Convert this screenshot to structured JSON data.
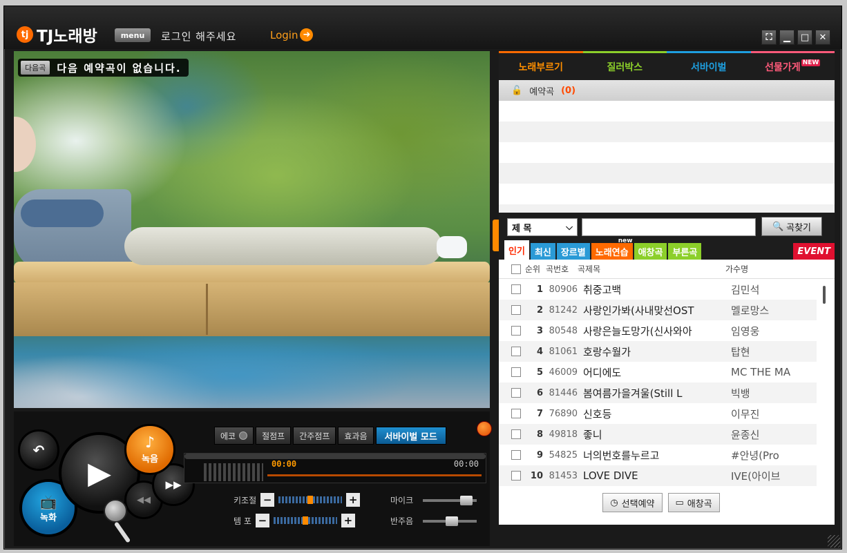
{
  "app": {
    "logo_text": "TJ노래방",
    "logo_badge": "tj",
    "menu_label": "menu",
    "login_message": "로그인 해주세요",
    "login_link": "Login",
    "window_controls": [
      "fullscreen-icon",
      "minimize-icon",
      "maximize-icon",
      "close-icon"
    ]
  },
  "video": {
    "next_tag": "다음곡",
    "next_message": "다음 예약곡이 없습니다."
  },
  "player": {
    "effects": {
      "echo": "에코",
      "half_jump": "절점프",
      "interlude_jump": "간주점프",
      "sound_effect": "효과음",
      "survival_mode": "서바이벌 모드"
    },
    "record_label": "녹음",
    "video_label": "녹화",
    "time_current": "00:00",
    "time_total": "00:00",
    "key_label": "키조절",
    "tempo_label": "템  포",
    "mic_label": "마이크",
    "accomp_label": "반주음",
    "key_level": 0.5,
    "tempo_level": 0.5,
    "mic_level": 0.9,
    "accomp_level": 0.55
  },
  "right_tabs": [
    "노래부르기",
    "질러박스",
    "서바이벌",
    "선물가게"
  ],
  "right_tabs_new": "NEW",
  "reserve": {
    "label": "예약곡",
    "count": "(0)"
  },
  "search": {
    "select_value": "제 목",
    "button_label": "곡찾기",
    "input_value": ""
  },
  "categories": [
    "인기",
    "최신",
    "장르별",
    "노래연습",
    "애창곡",
    "부른곡"
  ],
  "practice_new": "new",
  "event_label": "EVENT",
  "list_headers": {
    "rank": "순위",
    "number": "곡번호",
    "title": "곡제목",
    "artist": "가수명"
  },
  "songs": [
    {
      "rank": "1",
      "number": "80906",
      "title": "취중고백",
      "artist": "김민석"
    },
    {
      "rank": "2",
      "number": "81242",
      "title": "사랑인가봐(사내맞선OST",
      "artist": "멜로망스"
    },
    {
      "rank": "3",
      "number": "80548",
      "title": "사랑은늘도망가(신사와아",
      "artist": "임영웅"
    },
    {
      "rank": "4",
      "number": "81061",
      "title": "호랑수월가",
      "artist": "탑현"
    },
    {
      "rank": "5",
      "number": "46009",
      "title": "어디에도",
      "artist": "MC THE MA"
    },
    {
      "rank": "6",
      "number": "81446",
      "title": "봄여름가을겨울(Still L",
      "artist": "빅뱅"
    },
    {
      "rank": "7",
      "number": "76890",
      "title": "신호등",
      "artist": "이무진"
    },
    {
      "rank": "8",
      "number": "49818",
      "title": "좋니",
      "artist": "윤종신"
    },
    {
      "rank": "9",
      "number": "54825",
      "title": "너의번호를누르고",
      "artist": "#안녕(Pro"
    },
    {
      "rank": "10",
      "number": "81453",
      "title": "LOVE DIVE",
      "artist": "IVE(아이브"
    }
  ],
  "bottom_buttons": {
    "reserve_selected": "선택예약",
    "favorite": "애창곡"
  },
  "colors": {
    "accent_orange": "#ff8a00",
    "survival_blue": "#1e9fe0",
    "chiller_green": "#8ccf2a",
    "shop_pink": "#ff5a7a",
    "event_red": "#e01030"
  }
}
